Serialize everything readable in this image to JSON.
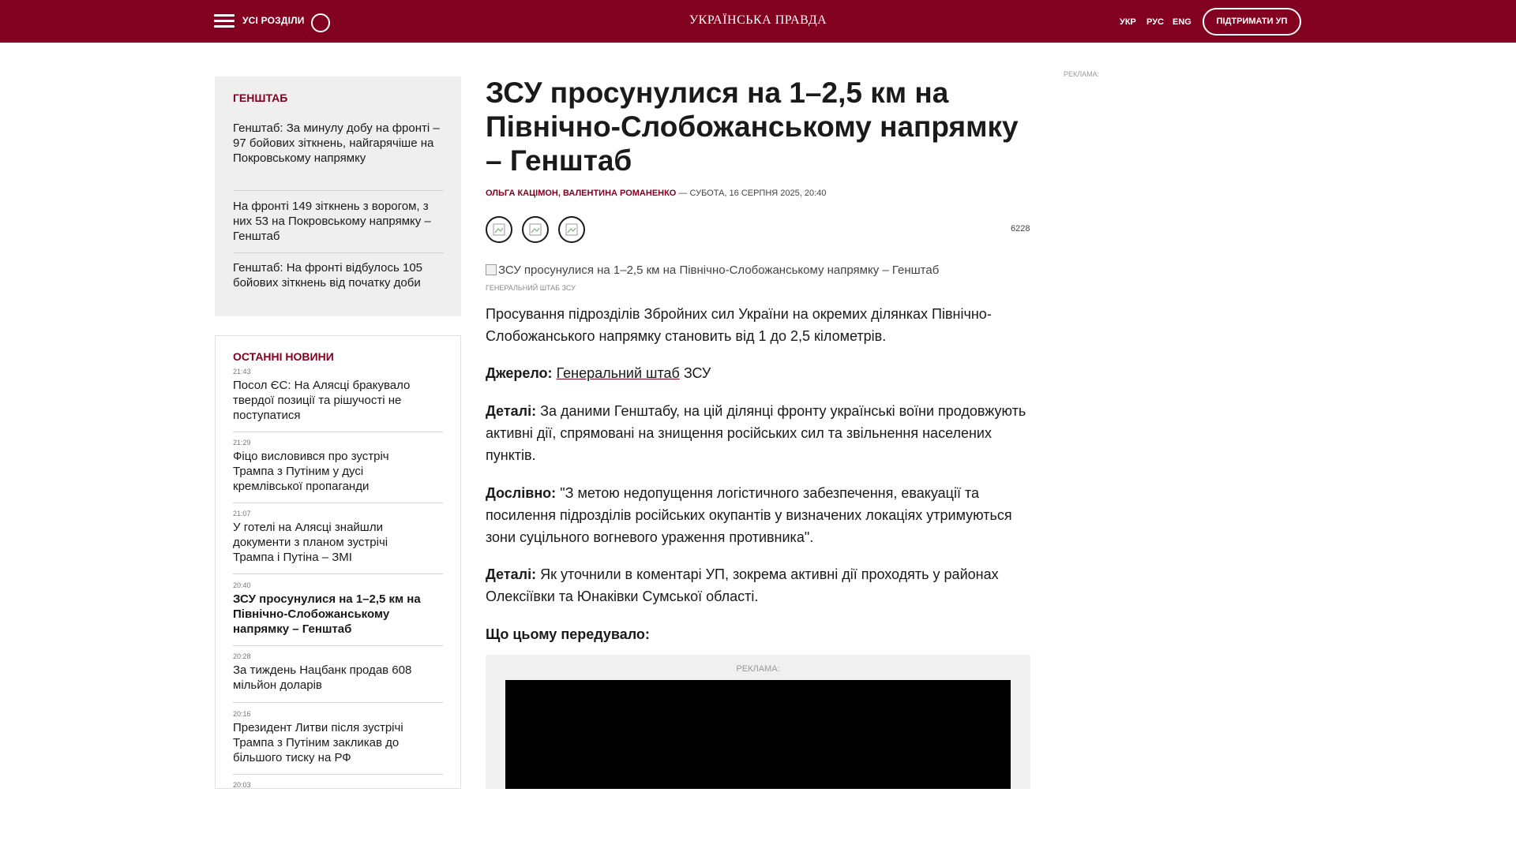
{
  "header": {
    "sections_label": "УСІ РОЗДІЛИ",
    "logo": "УКРАЇНСЬКА ПРАВДА",
    "languages": [
      "УКР",
      "РУС",
      "ENG"
    ],
    "support_label": "ПІДТРИМАТИ УП",
    "brand_color": "#820020"
  },
  "sidebar": {
    "genshtab": {
      "title": "ГЕНШТАБ",
      "items": [
        "Генштаб: За минулу добу на фронті – 97 бойових зіткнень, найгарячіше на Покровському напрямку",
        "На фронті 149 зіткнень з ворогом, з них 53 на Покровському напрямку – Генштаб",
        "Генштаб: На фронті відбулось 105 бойових зіткнень від початку доби"
      ]
    },
    "latest": {
      "title": "ОСТАННІ НОВИНИ",
      "items": [
        {
          "time": "21:43",
          "title": "Посол ЄС: На Алясці бракувало твердої позиції та рішучості не поступатися"
        },
        {
          "time": "21:29",
          "title": "Фіцо висловився про зустріч Трампа з Путіним у дусі кремлівської пропаганди"
        },
        {
          "time": "21:07",
          "title": "У готелі на Алясці знайшли документи з планом зустрічі Трампа і Путіна – ЗМІ"
        },
        {
          "time": "20:40",
          "title": "ЗСУ просунулися на 1–2,5 км на Північно-Слобожанському напрямку – Генштаб"
        },
        {
          "time": "20:28",
          "title": "За тиждень Нацбанк продав 608 мільйон доларів"
        },
        {
          "time": "20:16",
          "title": "Президент Литви після зустрічі Трампа з Путіним закликав до більшого тиску на РФ"
        },
        {
          "time": "20:03",
          "title": ""
        }
      ]
    }
  },
  "article": {
    "headline": "ЗСУ просунулися на 1–2,5 км на Північно-Слобожанському напрямку – Генштаб",
    "authors": "ОЛЬГА КАЦІМОН, ВАЛЕНТИНА РОМАНЕНКО",
    "separator": " — ",
    "date": "СУБОТА, 16 СЕРПНЯ 2025, 20:40",
    "views": "6228",
    "image_alt": "ЗСУ просунулися на 1–2,5 км на Північно-Слобожанському напрямку – Генштаб",
    "photo_credit": "ГЕНЕРАЛЬНИЙ ШТАБ ЗСУ",
    "p1": "Просування підрозділів Збройних сил України на окремих ділянках Північно-Слобожанського напрямку становить від 1 до 2,5 кілометрів.",
    "source_label": "Джерело:",
    "source_link": "Генеральний штаб",
    "source_rest": " ЗСУ",
    "details_label": "Деталі:",
    "details_text": " За даними Генштабу, на цій ділянці фронту українські воїни продовжують активні дії, спрямовані на знищення російських сил та звільнення населених пунктів.",
    "quote_label": "Дослівно:",
    "quote_text": " \"З метою недопущення логістичного забезпечення, евакуації та посилення підрозділів російських окупантів у визначених локаціях утримуються зони суцільного вогневого ураження противника\".",
    "details2_label": "Деталі:",
    "details2_text": " Як уточнили в коментарі УП, зокрема активні дії проходять у районах Олексіївки та Юнаківки Сумської області.",
    "preceded_label": "Що цьому передувало:"
  },
  "ads": {
    "label": "РЕКЛАМА:"
  }
}
